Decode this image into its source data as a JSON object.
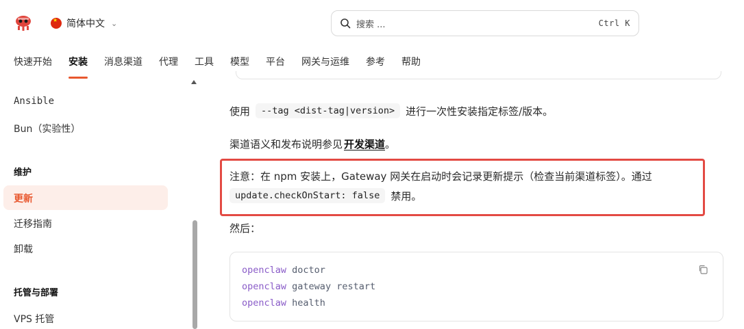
{
  "header": {
    "language": "简体中文",
    "search_placeholder": "搜索 ...",
    "search_shortcut": "Ctrl K"
  },
  "tabs": [
    {
      "label": "快速开始",
      "active": false
    },
    {
      "label": "安装",
      "active": true
    },
    {
      "label": "消息渠道",
      "active": false
    },
    {
      "label": "代理",
      "active": false
    },
    {
      "label": "工具",
      "active": false
    },
    {
      "label": "模型",
      "active": false
    },
    {
      "label": "平台",
      "active": false
    },
    {
      "label": "网关与运维",
      "active": false
    },
    {
      "label": "参考",
      "active": false
    },
    {
      "label": "帮助",
      "active": false
    }
  ],
  "sidebar": {
    "items_top": [
      "Ansible",
      "Bun（实验性）"
    ],
    "section_maintain": "维护",
    "maintain_items": [
      "更新",
      "迁移指南",
      "卸载"
    ],
    "active_item": "更新",
    "section_hosting": "托管与部署",
    "hosting_items": [
      "VPS 托管"
    ]
  },
  "content": {
    "p1_before": "使用",
    "p1_code": "--tag <dist-tag|version>",
    "p1_after": "进行一次性安装指定标签/版本。",
    "p2_text": "渠道语义和发布说明参见",
    "p2_link": "开发渠道",
    "p2_end": "。",
    "note_line1": "注意：在 npm 安装上，Gateway 网关在启动时会记录更新提示（检查当前渠道标签）。通过",
    "note_code": "update.checkOnStart: false",
    "note_after": "禁用。",
    "then": "然后：",
    "code_lines": [
      {
        "cmd": "openclaw",
        "args": "doctor"
      },
      {
        "cmd": "openclaw",
        "args": "gateway restart"
      },
      {
        "cmd": "openclaw",
        "args": "health"
      }
    ]
  },
  "colors": {
    "accent": "#e8572e",
    "highlight_border": "#e34a43",
    "code_keyword": "#8a5cc8"
  }
}
